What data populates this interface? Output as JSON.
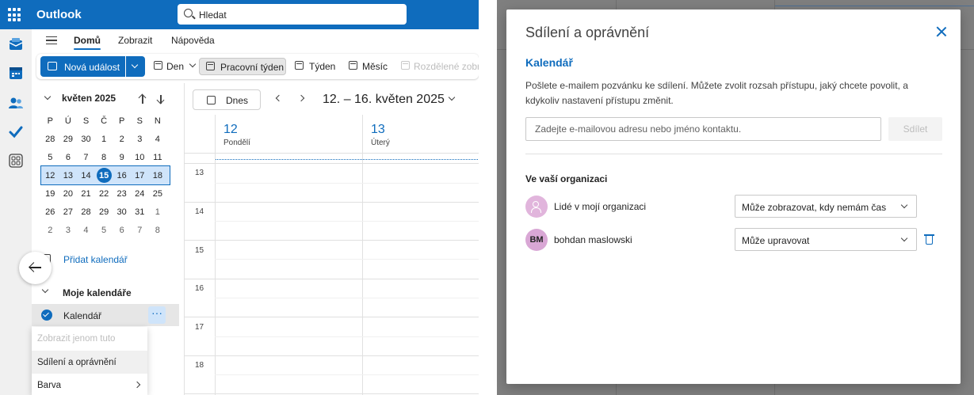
{
  "app": {
    "title": "Outlook"
  },
  "search": {
    "placeholder": "Hledat"
  },
  "rail": [
    "mail-icon",
    "calendar-icon",
    "people-icon",
    "todo-icon",
    "apps-icon"
  ],
  "menu": {
    "tabs": [
      "Domů",
      "Zobrazit",
      "Nápověda"
    ],
    "active": "Domů"
  },
  "ribbon": {
    "new_event": "Nová událost",
    "day": "Den",
    "work_week": "Pracovní týden",
    "week": "Týden",
    "month": "Měsíc",
    "split": "Rozdělené zobrazení"
  },
  "mini_calendar": {
    "title": "květen 2025",
    "weekdays": [
      "P",
      "Ú",
      "S",
      "Č",
      "P",
      "S",
      "N"
    ],
    "weeks": [
      [
        "28",
        "29",
        "30",
        "1",
        "2",
        "3",
        "4"
      ],
      [
        "5",
        "6",
        "7",
        "8",
        "9",
        "10",
        "11"
      ],
      [
        "12",
        "13",
        "14",
        "15",
        "16",
        "17",
        "18"
      ],
      [
        "19",
        "20",
        "21",
        "22",
        "23",
        "24",
        "25"
      ],
      [
        "26",
        "27",
        "28",
        "29",
        "30",
        "31",
        "1"
      ],
      [
        "2",
        "3",
        "4",
        "5",
        "6",
        "7",
        "8"
      ]
    ],
    "today": "15"
  },
  "sidebar": {
    "add_calendar": "Přidat kalendář",
    "my_calendars": "Moje kalendáře",
    "calendar_name": "Kalendář",
    "more": "···"
  },
  "context_menu": {
    "items": [
      "Zobrazit jenom tuto",
      "Sdílení a oprávnění",
      "Barva"
    ]
  },
  "calendar": {
    "today_button": "Dnes",
    "range": "12. – 16. květen 2025",
    "days": [
      {
        "num": "12",
        "name": "Pondělí"
      },
      {
        "num": "13",
        "name": "Úterý"
      }
    ],
    "hours": [
      "13",
      "14",
      "15",
      "16",
      "17",
      "18"
    ]
  },
  "dialog": {
    "title": "Sdílení a oprávnění",
    "subtitle": "Kalendář",
    "description": "Pošlete e-mailem pozvánku ke sdílení. Můžete zvolit rozsah přístupu, jaký chcete povolit, a kdykoliv nastavení přístupu změnit.",
    "email_placeholder": "Zadejte e-mailovou adresu nebo jméno kontaktu.",
    "share_button": "Sdílet",
    "org_heading": "Ve vaší organizaci",
    "people": [
      {
        "name": "Lidé v mojí organizaci",
        "initials": "",
        "permission": "Může zobrazovat, kdy nemám čas"
      },
      {
        "name": "bohdan maslowski",
        "initials": "BM",
        "permission": "Může upravovat"
      }
    ]
  }
}
